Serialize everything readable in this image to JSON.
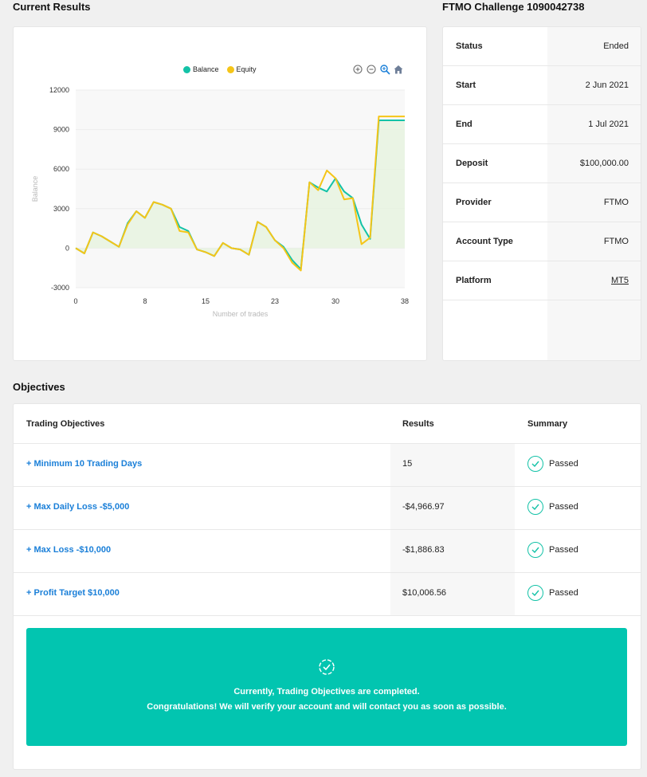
{
  "current_results_title": "Current Results",
  "challenge_title": "FTMO Challenge 1090042738",
  "objectives_title": "Objectives",
  "colors": {
    "balance": "#13c2a7",
    "equity": "#f5c518",
    "link": "#1a7fd8",
    "banner": "#02c5b0"
  },
  "chart_data": {
    "type": "line",
    "legend": [
      "Balance",
      "Equity"
    ],
    "xlabel": "Number of trades",
    "ylabel": "Balance",
    "xlim": [
      0,
      38
    ],
    "ylim": [
      -3000,
      12000
    ],
    "x_ticks": [
      0,
      8,
      15,
      23,
      30,
      38
    ],
    "y_ticks": [
      12000,
      9000,
      6000,
      3000,
      0,
      -3000
    ],
    "series": [
      {
        "name": "Balance",
        "x": [
          0,
          1,
          2,
          3,
          4,
          5,
          6,
          7,
          8,
          9,
          10,
          11,
          12,
          13,
          14,
          15,
          16,
          17,
          18,
          19,
          20,
          21,
          22,
          23,
          24,
          25,
          26,
          27,
          28,
          29,
          30,
          31,
          32,
          33,
          34,
          35,
          38
        ],
        "y": [
          0,
          -400,
          1200,
          900,
          500,
          100,
          1900,
          2800,
          2300,
          3500,
          3300,
          3000,
          1600,
          1300,
          -100,
          -300,
          -600,
          400,
          0,
          -100,
          -500,
          2000,
          1600,
          600,
          100,
          -900,
          -1600,
          5000,
          4600,
          4300,
          5300,
          4300,
          3800,
          1800,
          700,
          9700,
          9700
        ]
      },
      {
        "name": "Equity",
        "x": [
          0,
          1,
          2,
          3,
          4,
          5,
          6,
          7,
          8,
          9,
          10,
          11,
          12,
          13,
          14,
          15,
          16,
          17,
          18,
          19,
          20,
          21,
          22,
          23,
          24,
          25,
          26,
          27,
          28,
          29,
          30,
          31,
          32,
          33,
          34,
          35,
          38
        ],
        "y": [
          0,
          -400,
          1200,
          900,
          500,
          100,
          1800,
          2800,
          2300,
          3500,
          3300,
          3000,
          1300,
          1200,
          -100,
          -300,
          -600,
          400,
          0,
          -100,
          -500,
          2000,
          1600,
          600,
          0,
          -1100,
          -1700,
          5000,
          4400,
          5900,
          5300,
          3700,
          3800,
          300,
          800,
          10000,
          10000
        ]
      }
    ]
  },
  "toolbar": [
    "zoom-in-icon",
    "zoom-out-icon",
    "magnify-icon",
    "home-icon"
  ],
  "info": [
    {
      "label": "Status",
      "value": "Ended"
    },
    {
      "label": "Start",
      "value": "2 Jun 2021"
    },
    {
      "label": "End",
      "value": "1 Jul 2021"
    },
    {
      "label": "Deposit",
      "value": "$100,000.00"
    },
    {
      "label": "Provider",
      "value": "FTMO"
    },
    {
      "label": "Account Type",
      "value": "FTMO"
    },
    {
      "label": "Platform",
      "value": "MT5"
    }
  ],
  "objectives": {
    "headers": {
      "name": "Trading Objectives",
      "results": "Results",
      "summary": "Summary"
    },
    "rows": [
      {
        "name": "+ Minimum 10 Trading Days",
        "result": "15",
        "summary": "Passed"
      },
      {
        "name": "+ Max Daily Loss -$5,000",
        "result": "-$4,966.97",
        "summary": "Passed"
      },
      {
        "name": "+ Max Loss -$10,000",
        "result": "-$1,886.83",
        "summary": "Passed"
      },
      {
        "name": "+ Profit Target $10,000",
        "result": "$10,006.56",
        "summary": "Passed"
      }
    ],
    "banner_line1": "Currently, Trading Objectives are completed.",
    "banner_line2": "Congratulations! We will verify your account and will contact you as soon as possible."
  }
}
